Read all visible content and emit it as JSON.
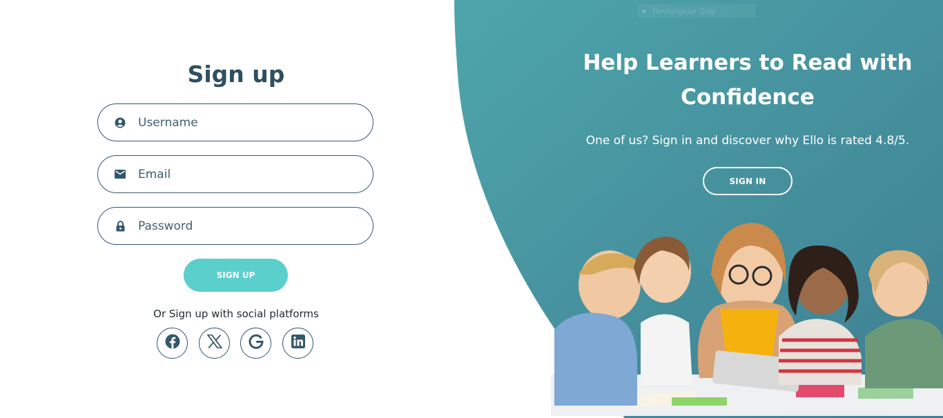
{
  "colors": {
    "teal_panel": "#4a9aa3",
    "teal_dark": "#3f7f92",
    "signup_button": "#5bcfcc",
    "text_dark": "#2f4f60"
  },
  "ghost_label": "Rectangular Snip",
  "promo": {
    "title": "Help Learners to Read with Confidence",
    "subtitle": "One of us? Sign in and discover why Ello is rated 4.8/5.",
    "signin_label": "SIGN IN"
  },
  "form": {
    "title": "Sign up",
    "username": {
      "placeholder": "Username",
      "icon": "user-circle-icon"
    },
    "email": {
      "placeholder": "Email",
      "icon": "mail-icon"
    },
    "password": {
      "placeholder": "Password",
      "icon": "lock-icon"
    },
    "signup_label": "SIGN UP",
    "social_text": "Or Sign up with social platforms",
    "social": [
      {
        "name": "facebook-icon"
      },
      {
        "name": "x-icon"
      },
      {
        "name": "google-icon"
      },
      {
        "name": "linkedin-icon"
      }
    ]
  },
  "illustration": {
    "name": "teacher-and-children-reading-tablet-photo"
  }
}
